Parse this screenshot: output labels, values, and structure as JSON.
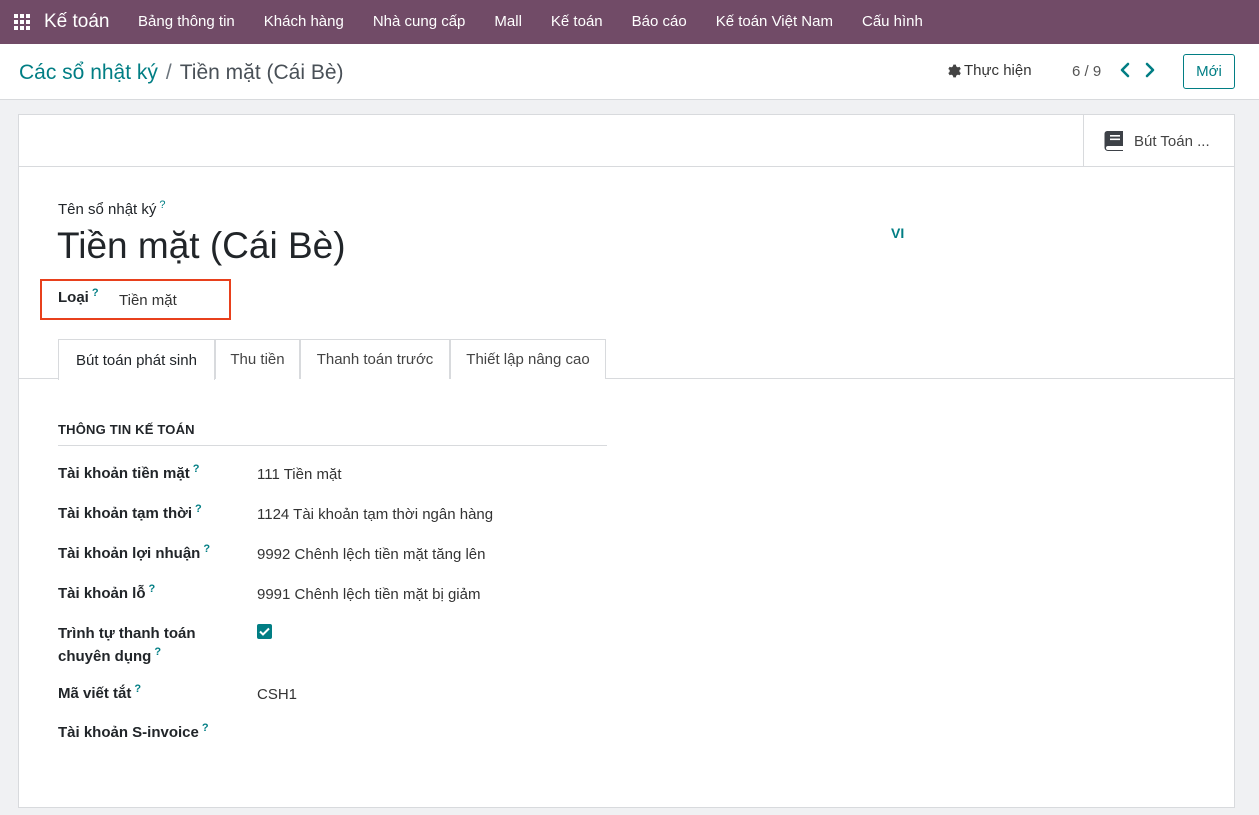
{
  "navbar": {
    "brand": "Kế toán",
    "items": [
      "Bảng thông tin",
      "Khách hàng",
      "Nhà cung cấp",
      "Mall",
      "Kế toán",
      "Báo cáo",
      "Kế toán Việt Nam",
      "Cấu hình"
    ]
  },
  "control": {
    "breadcrumb_parent": "Các sổ nhật ký",
    "breadcrumb_sep": "/",
    "breadcrumb_current": "Tiền mặt (Cái Bè)",
    "action_label": "Thực hiện",
    "pager": "6 / 9",
    "new_label": "Mới"
  },
  "sheet": {
    "stat_button_label": "Bút Toán ...",
    "name_label": "Tên sổ nhật ký",
    "help_mark": "?",
    "name_value": "Tiền mặt (Cái Bè)",
    "lang": "VI",
    "type_label": "Loại",
    "type_value": "Tiền mặt"
  },
  "tabs": [
    "Bút toán phát sinh",
    "Thu tiền",
    "Thanh toán trước",
    "Thiết lập nâng cao"
  ],
  "group": {
    "title": "THÔNG TIN KẾ TOÁN",
    "fields": [
      {
        "label": "Tài khoản tiền mặt",
        "value": "111 Tiền mặt"
      },
      {
        "label": "Tài khoản tạm thời",
        "value": "1124 Tài khoản tạm thời ngân hàng"
      },
      {
        "label": "Tài khoản lợi nhuận",
        "value": "9992 Chênh lệch tiền mặt tăng lên"
      },
      {
        "label": "Tài khoản lỗ",
        "value": "9991 Chênh lệch tiền mặt bị giảm"
      },
      {
        "label_line1": "Trình tự thanh toán",
        "label_line2": "chuyên dụng",
        "checked": true
      },
      {
        "label": "Mã viết tắt",
        "value": "CSH1"
      },
      {
        "label": "Tài khoản S-invoice",
        "value": ""
      }
    ]
  },
  "colors": {
    "navbar": "#714b67",
    "accent": "#017e84",
    "highlight_box": "#e8401c"
  }
}
